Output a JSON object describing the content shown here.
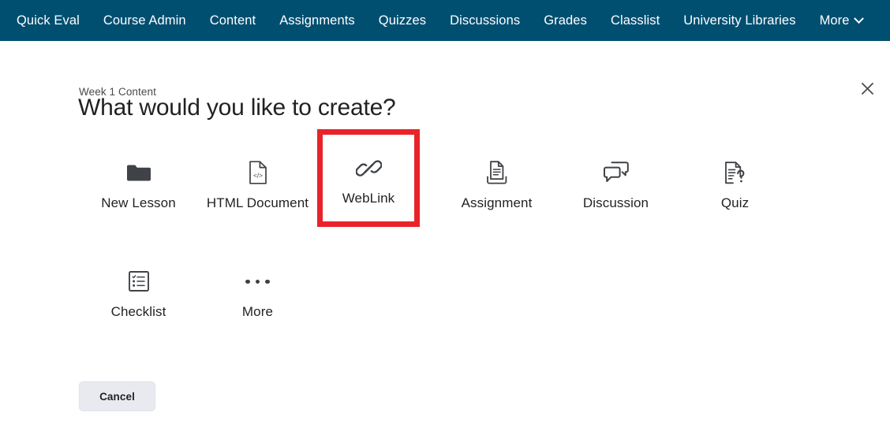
{
  "nav": {
    "background_color": "#004f71",
    "items": [
      {
        "label": "Quick Eval",
        "icon": null
      },
      {
        "label": "Course Admin",
        "icon": null
      },
      {
        "label": "Content",
        "icon": null
      },
      {
        "label": "Assignments",
        "icon": null
      },
      {
        "label": "Quizzes",
        "icon": null
      },
      {
        "label": "Discussions",
        "icon": null
      },
      {
        "label": "Grades",
        "icon": null
      },
      {
        "label": "Classlist",
        "icon": null
      },
      {
        "label": "University Libraries",
        "icon": null
      },
      {
        "label": "More",
        "icon": "chevron-down-icon"
      }
    ]
  },
  "dialog": {
    "breadcrumb": "Week 1 Content",
    "title": "What would you like to create?",
    "close_icon": "close-icon",
    "close_label": "✕",
    "cancel_label": "Cancel",
    "highlight_color": "#e8242a",
    "highlighted_option": "WebLink",
    "options_row1": [
      {
        "label": "New Lesson",
        "icon": "folder-icon"
      },
      {
        "label": "HTML Document",
        "icon": "html-file-icon"
      },
      {
        "label": "WebLink",
        "icon": "chain-link-icon"
      },
      {
        "label": "Assignment",
        "icon": "assignment-tray-icon"
      },
      {
        "label": "Discussion",
        "icon": "speech-bubbles-icon"
      },
      {
        "label": "Quiz",
        "icon": "quiz-question-icon"
      }
    ],
    "options_row2": [
      {
        "label": "Checklist",
        "icon": "checklist-icon"
      },
      {
        "label": "More",
        "icon": "ellipsis-icon"
      }
    ]
  }
}
